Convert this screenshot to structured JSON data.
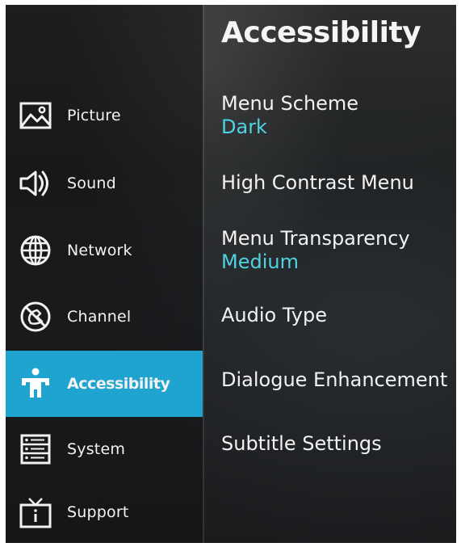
{
  "sidebar": {
    "items": [
      {
        "label": "Picture",
        "icon": "picture-icon"
      },
      {
        "label": "Sound",
        "icon": "speaker-icon"
      },
      {
        "label": "Network",
        "icon": "globe-icon"
      },
      {
        "label": "Channel",
        "icon": "channel-icon"
      },
      {
        "label": "Accessibility",
        "icon": "accessibility-icon",
        "selected": true
      },
      {
        "label": "System",
        "icon": "system-icon"
      },
      {
        "label": "Support",
        "icon": "tv-info-icon"
      }
    ]
  },
  "panel": {
    "title": "Accessibility",
    "settings": [
      {
        "label": "Menu Scheme",
        "value": "Dark"
      },
      {
        "label": "High Contrast Menu"
      },
      {
        "label": "Menu Transparency",
        "value": "Medium"
      },
      {
        "label": "Audio Type"
      },
      {
        "label": "Dialogue Enhancement"
      },
      {
        "label": "Subtitle Settings"
      }
    ]
  },
  "colors": {
    "selected_bg": "#1fa3cf",
    "value_text": "#4fd3e2"
  }
}
